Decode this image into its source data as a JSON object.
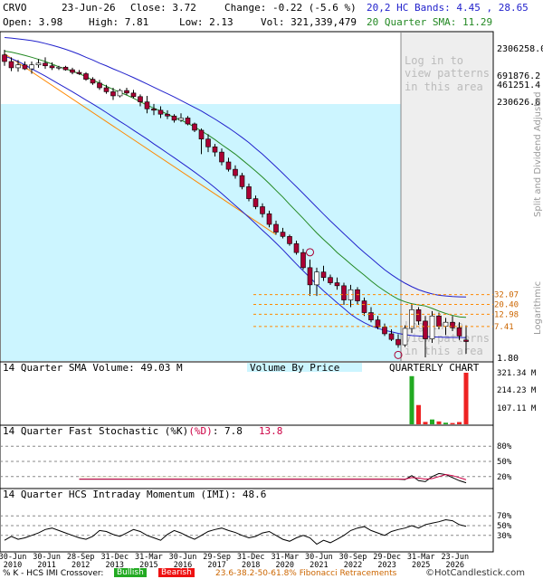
{
  "header": {
    "symbol": "CRVO",
    "date": "23-Jun-26",
    "close": "Close: 3.72",
    "change": "Change: -0.22 (-5.6 %)",
    "open": "Open: 3.98",
    "high": "High: 7.81",
    "low": "Low: 2.13",
    "vol": "Vol: 321,339,479",
    "hc_bands": "20,2 HC Bands: 4.45 , 28.65",
    "sma": "20 Quarter SMA: 11.29"
  },
  "watermark": {
    "line1": "Log in to",
    "line2": "view patterns",
    "line3": "in this area"
  },
  "side_labels": {
    "split": "Split and Dividend Adjusted",
    "scale": "Logarithmic"
  },
  "panels": {
    "volume_title": "14 Quarter SMA Volume: 49.03 M",
    "vbp_label": "Volume By Price",
    "chart_label": "QUARTERLY CHART",
    "stoch_title": "14 Quarter Fast Stochastic (%K)",
    "stoch_d": "(%D)",
    "stoch_k_val": ": 7.8",
    "stoch_d_val": "13.8",
    "imi_title": "14 Quarter HCS Intraday Momentum (IMI): 48.6"
  },
  "footer": {
    "prefix": "% K - HCS IMI Crossover:",
    "bullish": "Bullish",
    "bearish": "Bearish",
    "fib": "23.6-38.2-50-61.8% Fibonacci Retracements",
    "brand": "©HotCandlestick.com"
  },
  "colors": {
    "bull": "#ffffff",
    "bear": "#aa0033",
    "sma": "#228822",
    "band": "#2222cc",
    "trend": "#ff8800",
    "highlight": "#ccf5ff",
    "vol_green": "#22aa22",
    "vol_red": "#ee2222"
  },
  "chart_data": {
    "type": "candlestick",
    "scale": "log",
    "x_ticks": [
      "30-Jun 2010",
      "30-Jun 2011",
      "28-Sep 2012",
      "31-Dec 2013",
      "31-Mar 2015",
      "30-Jun 2016",
      "29-Sep 2017",
      "31-Dec 2018",
      "31-Mar 2020",
      "30-Jun 2021",
      "30-Sep 2022",
      "29-Dec 2023",
      "31-Mar 2025",
      "23-Jun 2026"
    ],
    "y_ticks": [
      "2306258.0",
      "691876.2",
      "461251.4",
      "230626.6",
      "1.80"
    ],
    "fib_levels": [
      32.07,
      20.4,
      12.98,
      7.41
    ],
    "fib_labels": [
      "32.07",
      "20.40",
      "12.98",
      "7.41"
    ],
    "volume_ticks": [
      "321.34 M",
      "214.23 M",
      "107.11 M"
    ],
    "stoch_ticks": [
      "80%",
      "50%",
      "20%"
    ],
    "imi_ticks": [
      "70%",
      "50%",
      "30%"
    ],
    "candles": [
      {
        "o": 1900000,
        "h": 2400000,
        "l": 1150000,
        "c": 1400000
      },
      {
        "o": 1400000,
        "h": 1700000,
        "l": 900000,
        "c": 1050000
      },
      {
        "o": 1050000,
        "h": 1500000,
        "l": 880000,
        "c": 1200000
      },
      {
        "o": 1200000,
        "h": 1400000,
        "l": 950000,
        "c": 1000000
      },
      {
        "o": 1000000,
        "h": 1400000,
        "l": 800000,
        "c": 1200000
      },
      {
        "o": 1200000,
        "h": 1550000,
        "l": 1050000,
        "c": 1300000
      },
      {
        "o": 1300000,
        "h": 1700000,
        "l": 1000000,
        "c": 1150000
      },
      {
        "o": 1150000,
        "h": 1350000,
        "l": 950000,
        "c": 1050000
      },
      {
        "o": 1050000,
        "h": 1150000,
        "l": 950000,
        "c": 1080000
      },
      {
        "o": 1080000,
        "h": 1150000,
        "l": 920000,
        "c": 960000
      },
      {
        "o": 960000,
        "h": 1050000,
        "l": 780000,
        "c": 850000
      },
      {
        "o": 850000,
        "h": 950000,
        "l": 760000,
        "c": 800000
      },
      {
        "o": 800000,
        "h": 860000,
        "l": 580000,
        "c": 620000
      },
      {
        "o": 620000,
        "h": 680000,
        "l": 480000,
        "c": 520000
      },
      {
        "o": 520000,
        "h": 600000,
        "l": 380000,
        "c": 420000
      },
      {
        "o": 420000,
        "h": 480000,
        "l": 320000,
        "c": 350000
      },
      {
        "o": 350000,
        "h": 420000,
        "l": 240000,
        "c": 290000
      },
      {
        "o": 290000,
        "h": 400000,
        "l": 270000,
        "c": 370000
      },
      {
        "o": 370000,
        "h": 420000,
        "l": 300000,
        "c": 330000
      },
      {
        "o": 330000,
        "h": 380000,
        "l": 260000,
        "c": 280000
      },
      {
        "o": 280000,
        "h": 310000,
        "l": 180000,
        "c": 220000
      },
      {
        "o": 220000,
        "h": 290000,
        "l": 130000,
        "c": 160000
      },
      {
        "o": 160000,
        "h": 200000,
        "l": 120000,
        "c": 150000
      },
      {
        "o": 150000,
        "h": 180000,
        "l": 105000,
        "c": 125000
      },
      {
        "o": 125000,
        "h": 150000,
        "l": 100000,
        "c": 115000
      },
      {
        "o": 115000,
        "h": 125000,
        "l": 85000,
        "c": 95000
      },
      {
        "o": 95000,
        "h": 130000,
        "l": 88000,
        "c": 105000
      },
      {
        "o": 105000,
        "h": 115000,
        "l": 75000,
        "c": 80000
      },
      {
        "o": 80000,
        "h": 85000,
        "l": 55000,
        "c": 60000
      },
      {
        "o": 60000,
        "h": 65000,
        "l": 20000,
        "c": 40000
      },
      {
        "o": 40000,
        "h": 50000,
        "l": 22000,
        "c": 28000
      },
      {
        "o": 28000,
        "h": 32000,
        "l": 18000,
        "c": 22000
      },
      {
        "o": 22000,
        "h": 26000,
        "l": 12000,
        "c": 14000
      },
      {
        "o": 14000,
        "h": 17000,
        "l": 9000,
        "c": 10000
      },
      {
        "o": 10000,
        "h": 12000,
        "l": 6500,
        "c": 7500
      },
      {
        "o": 7500,
        "h": 8500,
        "l": 4000,
        "c": 4500
      },
      {
        "o": 4500,
        "h": 5200,
        "l": 2300,
        "c": 2600
      },
      {
        "o": 2600,
        "h": 3000,
        "l": 1600,
        "c": 1800
      },
      {
        "o": 1800,
        "h": 2100,
        "l": 1100,
        "c": 1300
      },
      {
        "o": 1300,
        "h": 1500,
        "l": 700,
        "c": 800
      },
      {
        "o": 800,
        "h": 950,
        "l": 500,
        "c": 560
      },
      {
        "o": 560,
        "h": 680,
        "l": 420,
        "c": 460
      },
      {
        "o": 460,
        "h": 500,
        "l": 300,
        "c": 330
      },
      {
        "o": 330,
        "h": 380,
        "l": 200,
        "c": 220
      },
      {
        "o": 220,
        "h": 260,
        "l": 100,
        "c": 110
      },
      {
        "o": 110,
        "h": 160,
        "l": 30,
        "c": 50
      },
      {
        "o": 50,
        "h": 110,
        "l": 30,
        "c": 90
      },
      {
        "o": 90,
        "h": 120,
        "l": 60,
        "c": 70
      },
      {
        "o": 70,
        "h": 80,
        "l": 50,
        "c": 55
      },
      {
        "o": 55,
        "h": 70,
        "l": 40,
        "c": 48
      },
      {
        "o": 48,
        "h": 55,
        "l": 20,
        "c": 25
      },
      {
        "o": 25,
        "h": 50,
        "l": 18,
        "c": 40
      },
      {
        "o": 40,
        "h": 45,
        "l": 20,
        "c": 24
      },
      {
        "o": 24,
        "h": 28,
        "l": 12,
        "c": 14
      },
      {
        "o": 14,
        "h": 18,
        "l": 9,
        "c": 10
      },
      {
        "o": 10,
        "h": 12,
        "l": 6.5,
        "c": 7.2
      },
      {
        "o": 7.2,
        "h": 8.5,
        "l": 4.8,
        "c": 5.3
      },
      {
        "o": 5.3,
        "h": 6.5,
        "l": 3.8,
        "c": 4.1
      },
      {
        "o": 4.1,
        "h": 5.2,
        "l": 2.8,
        "c": 3.2
      },
      {
        "o": 3.2,
        "h": 7.8,
        "l": 2.9,
        "c": 6.8
      },
      {
        "o": 6.8,
        "h": 21,
        "l": 5.5,
        "c": 16
      },
      {
        "o": 16,
        "h": 18,
        "l": 8,
        "c": 9.5
      },
      {
        "o": 9.5,
        "h": 12,
        "l": 1.8,
        "c": 4.2
      },
      {
        "o": 4.2,
        "h": 15,
        "l": 3.5,
        "c": 12
      },
      {
        "o": 12,
        "h": 14,
        "l": 6.5,
        "c": 7.5
      },
      {
        "o": 7.5,
        "h": 11,
        "l": 5,
        "c": 9
      },
      {
        "o": 9,
        "h": 12,
        "l": 6,
        "c": 7
      },
      {
        "o": 7,
        "h": 9,
        "l": 4,
        "c": 4.8
      },
      {
        "o": 3.98,
        "h": 7.81,
        "l": 2.13,
        "c": 3.72
      }
    ],
    "sma": [
      2250000,
      2150000,
      2000000,
      1850000,
      1700000,
      1550000,
      1400000,
      1250000,
      1100000,
      1000000,
      900000,
      800000,
      700000,
      600000,
      520000,
      450000,
      390000,
      340000,
      300000,
      260000,
      220000,
      190000,
      165000,
      145000,
      125000,
      108000,
      95000,
      82000,
      70000,
      58000,
      48000,
      39000,
      31000,
      25000,
      20000,
      15500,
      12000,
      9200,
      7000,
      5200,
      3800,
      2800,
      2000,
      1450,
      1050,
      750,
      540,
      400,
      300,
      220,
      170,
      130,
      100,
      78,
      60,
      47,
      38,
      31,
      26,
      23,
      21,
      20,
      19,
      17,
      15,
      13.5,
      12.3,
      11.5,
      11.29
    ],
    "upper_band": [
      4200000,
      4100000,
      3950000,
      3800000,
      3650000,
      3450000,
      3200000,
      2950000,
      2700000,
      2450000,
      2200000,
      1950000,
      1700000,
      1500000,
      1300000,
      1150000,
      1000000,
      880000,
      770000,
      670000,
      580000,
      500000,
      430000,
      370000,
      320000,
      275000,
      235000,
      200000,
      170000,
      145000,
      120000,
      100000,
      82000,
      67000,
      54000,
      43000,
      34000,
      26000,
      20000,
      15000,
      11200,
      8300,
      6100,
      4500,
      3300,
      2400,
      1750,
      1280,
      940,
      700,
      520,
      390,
      290,
      220,
      170,
      130,
      100,
      80,
      65,
      54,
      46,
      40,
      36,
      33,
      31,
      30,
      29.3,
      28.9,
      28.65
    ],
    "lower_band": [
      1800000,
      1600000,
      1400000,
      1200000,
      1000000,
      850000,
      720000,
      600000,
      500000,
      420000,
      350000,
      290000,
      240000,
      200000,
      165000,
      135000,
      110000,
      90000,
      74000,
      60000,
      49000,
      40000,
      32000,
      26000,
      21000,
      17000,
      13700,
      11000,
      8800,
      7000,
      5500,
      4300,
      3300,
      2500,
      1900,
      1450,
      1100,
      820,
      610,
      460,
      340,
      250,
      180,
      130,
      95,
      70,
      51,
      38,
      29,
      22,
      17,
      13,
      10.5,
      8.8,
      7.6,
      6.8,
      6.2,
      5.8,
      5.4,
      5.1,
      4.9,
      4.8,
      4.7,
      4.6,
      4.55,
      4.5,
      4.48,
      4.46,
      4.45
    ],
    "volume": [
      1,
      1,
      1,
      1,
      1,
      1,
      1,
      1,
      1,
      1,
      1,
      1,
      1,
      1,
      1,
      1,
      1,
      1,
      1,
      1,
      1,
      1,
      1,
      1,
      1,
      1,
      1,
      1,
      1,
      1,
      1,
      1,
      1,
      1,
      1,
      1,
      1,
      1,
      1,
      1,
      1,
      1,
      1,
      1,
      1,
      1,
      1,
      1,
      1,
      1,
      1,
      1,
      1,
      1,
      1,
      1,
      1,
      1,
      1,
      2,
      300,
      120,
      15,
      30,
      18,
      10,
      8,
      14,
      321.34
    ],
    "stoch_k": [
      15,
      15,
      15,
      15,
      15,
      15,
      15,
      15,
      15,
      15,
      15,
      15,
      15,
      15,
      15,
      15,
      15,
      15,
      15,
      15,
      15,
      15,
      15,
      15,
      15,
      15,
      15,
      15,
      15,
      15,
      15,
      15,
      15,
      15,
      15,
      15,
      15,
      15,
      15,
      15,
      15,
      15,
      15,
      15,
      15,
      15,
      15,
      15,
      15,
      15,
      15,
      15,
      15,
      15,
      15,
      15,
      15,
      15,
      15,
      14,
      22,
      12,
      10,
      20,
      26,
      24,
      18,
      12,
      7.8
    ],
    "stoch_d": [
      15,
      15,
      15,
      15,
      15,
      15,
      15,
      15,
      15,
      15,
      15,
      15,
      15,
      15,
      15,
      15,
      15,
      15,
      15,
      15,
      15,
      15,
      15,
      15,
      15,
      15,
      15,
      15,
      15,
      15,
      15,
      15,
      15,
      15,
      15,
      15,
      15,
      15,
      15,
      15,
      15,
      15,
      15,
      15,
      15,
      15,
      15,
      15,
      15,
      15,
      15,
      15,
      15,
      15,
      15,
      15,
      15,
      15,
      15,
      15,
      18,
      17,
      15,
      16,
      20,
      24,
      22,
      18,
      13.8
    ],
    "imi": [
      20,
      28,
      22,
      25,
      30,
      35,
      42,
      45,
      40,
      35,
      30,
      25,
      22,
      28,
      40,
      38,
      32,
      28,
      35,
      42,
      38,
      30,
      25,
      20,
      32,
      40,
      35,
      28,
      22,
      30,
      38,
      42,
      45,
      40,
      36,
      30,
      25,
      28,
      35,
      38,
      30,
      22,
      18,
      25,
      30,
      25,
      12,
      20,
      15,
      22,
      30,
      40,
      45,
      48,
      40,
      35,
      30,
      38,
      42,
      45,
      50,
      45,
      52,
      55,
      58,
      62,
      60,
      52,
      48.6
    ]
  }
}
